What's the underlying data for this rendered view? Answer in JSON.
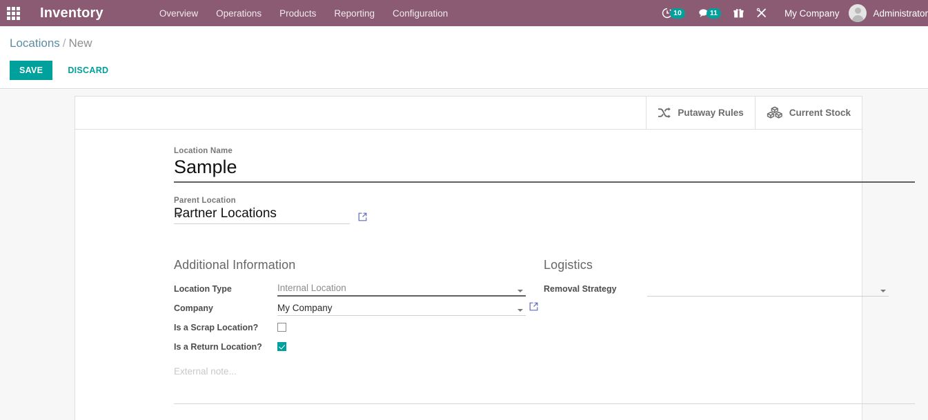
{
  "navbar": {
    "apps_icon": "apps-grid-icon",
    "brand": "Inventory",
    "menu": [
      {
        "label": "Overview"
      },
      {
        "label": "Operations"
      },
      {
        "label": "Products"
      },
      {
        "label": "Reporting"
      },
      {
        "label": "Configuration"
      }
    ],
    "systray": [
      {
        "icon": "activity-clock-icon",
        "count": "10"
      },
      {
        "icon": "messages-bubble-icon",
        "count": "11"
      },
      {
        "icon": "gift-box-icon",
        "count": ""
      },
      {
        "icon": "tools-cross-icon",
        "count": ""
      }
    ],
    "company": "My Company",
    "user": "Administrator",
    "bg_color": "#8a5b72",
    "badge_color": "#00a09d"
  },
  "control_panel": {
    "breadcrumb_root": "Locations",
    "breadcrumb_separator": "/",
    "breadcrumb_current": "New",
    "save_label": "SAVE",
    "discard_label": "DISCARD",
    "accent_color": "#00a09d"
  },
  "button_box": [
    {
      "icon": "shuffle-icon",
      "label": "Putaway Rules"
    },
    {
      "icon": "cubes-icon",
      "label": "Current Stock"
    }
  ],
  "form": {
    "location_name": {
      "label": "Location Name",
      "value": "Sample",
      "placeholder": ""
    },
    "parent_location": {
      "label": "Parent Location",
      "value": "Partner Locations",
      "placeholder": ""
    },
    "groups": {
      "additional_information": {
        "title": "Additional Information",
        "fields": {
          "location_type": {
            "label": "Location Type",
            "value": "Internal Location"
          },
          "company": {
            "label": "Company",
            "value": "My Company"
          },
          "is_scrap_location": {
            "label": "Is a Scrap Location?",
            "checked": false
          },
          "is_return_location": {
            "label": "Is a Return Location?",
            "checked": true
          }
        }
      },
      "logistics": {
        "title": "Logistics",
        "fields": {
          "removal_strategy": {
            "label": "Removal Strategy",
            "value": ""
          }
        }
      }
    },
    "note": {
      "value": "",
      "placeholder": "External note..."
    }
  }
}
